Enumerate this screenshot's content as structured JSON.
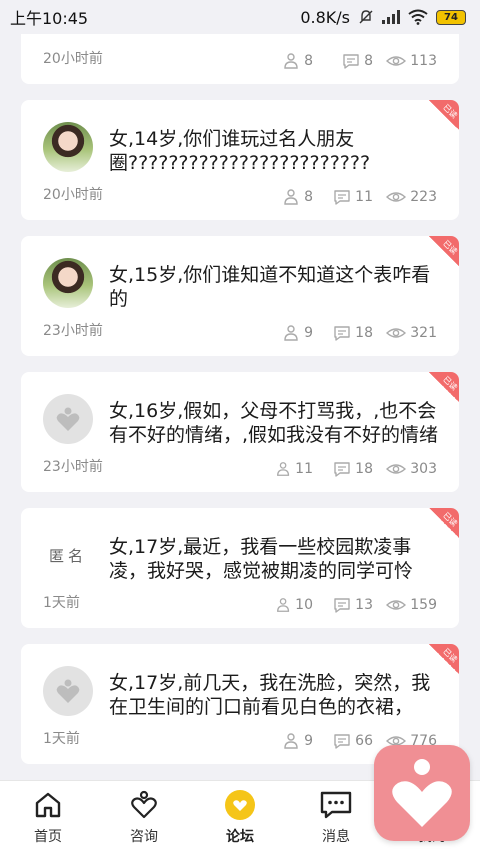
{
  "status_bar": {
    "time": "上午10:45",
    "speed": "0.8K/s",
    "battery": "74"
  },
  "posts": [
    {
      "title": "",
      "time": "20小时前",
      "likes": "8",
      "comments": "8",
      "views": "113",
      "avatar": "none",
      "badge": ""
    },
    {
      "title": "女,14岁,你们谁玩过名人朋友圈????????????????????????",
      "time": "20小时前",
      "likes": "8",
      "comments": "11",
      "views": "223",
      "avatar": "photo",
      "badge": "已读"
    },
    {
      "title": "女,15岁,你们谁知道不知道这个表咋看的",
      "time": "23小时前",
      "likes": "9",
      "comments": "18",
      "views": "321",
      "avatar": "photo",
      "badge": "已读"
    },
    {
      "title": "女,16岁,假如，父母不打骂我，,也不会有不好的情绪，,假如我没有不好的情绪",
      "time": "23小时前",
      "likes": "11",
      "comments": "18",
      "views": "303",
      "avatar": "default",
      "badge": "已读"
    },
    {
      "title": "女,17岁,最近，我看一些校园欺凌事凌，我好哭，感觉被期凌的同学可怜",
      "time": "1天前",
      "likes": "10",
      "comments": "13",
      "views": "159",
      "avatar": "anon",
      "anon_label": "匿名",
      "badge": "已读"
    },
    {
      "title": "女,17岁,前几天，我在洗脸，突然，我在卫生间的门口前看见白色的衣裙，",
      "time": "1天前",
      "likes": "9",
      "comments": "66",
      "views": "776",
      "avatar": "default",
      "badge": "已读"
    }
  ],
  "tabbar": {
    "home": "首页",
    "consult": "咨询",
    "forum": "论坛",
    "messages": "消息",
    "mine": "我的"
  },
  "colors": {
    "accent": "#f5c518",
    "badge": "#f26b6b",
    "float_app": "#f08f94"
  }
}
